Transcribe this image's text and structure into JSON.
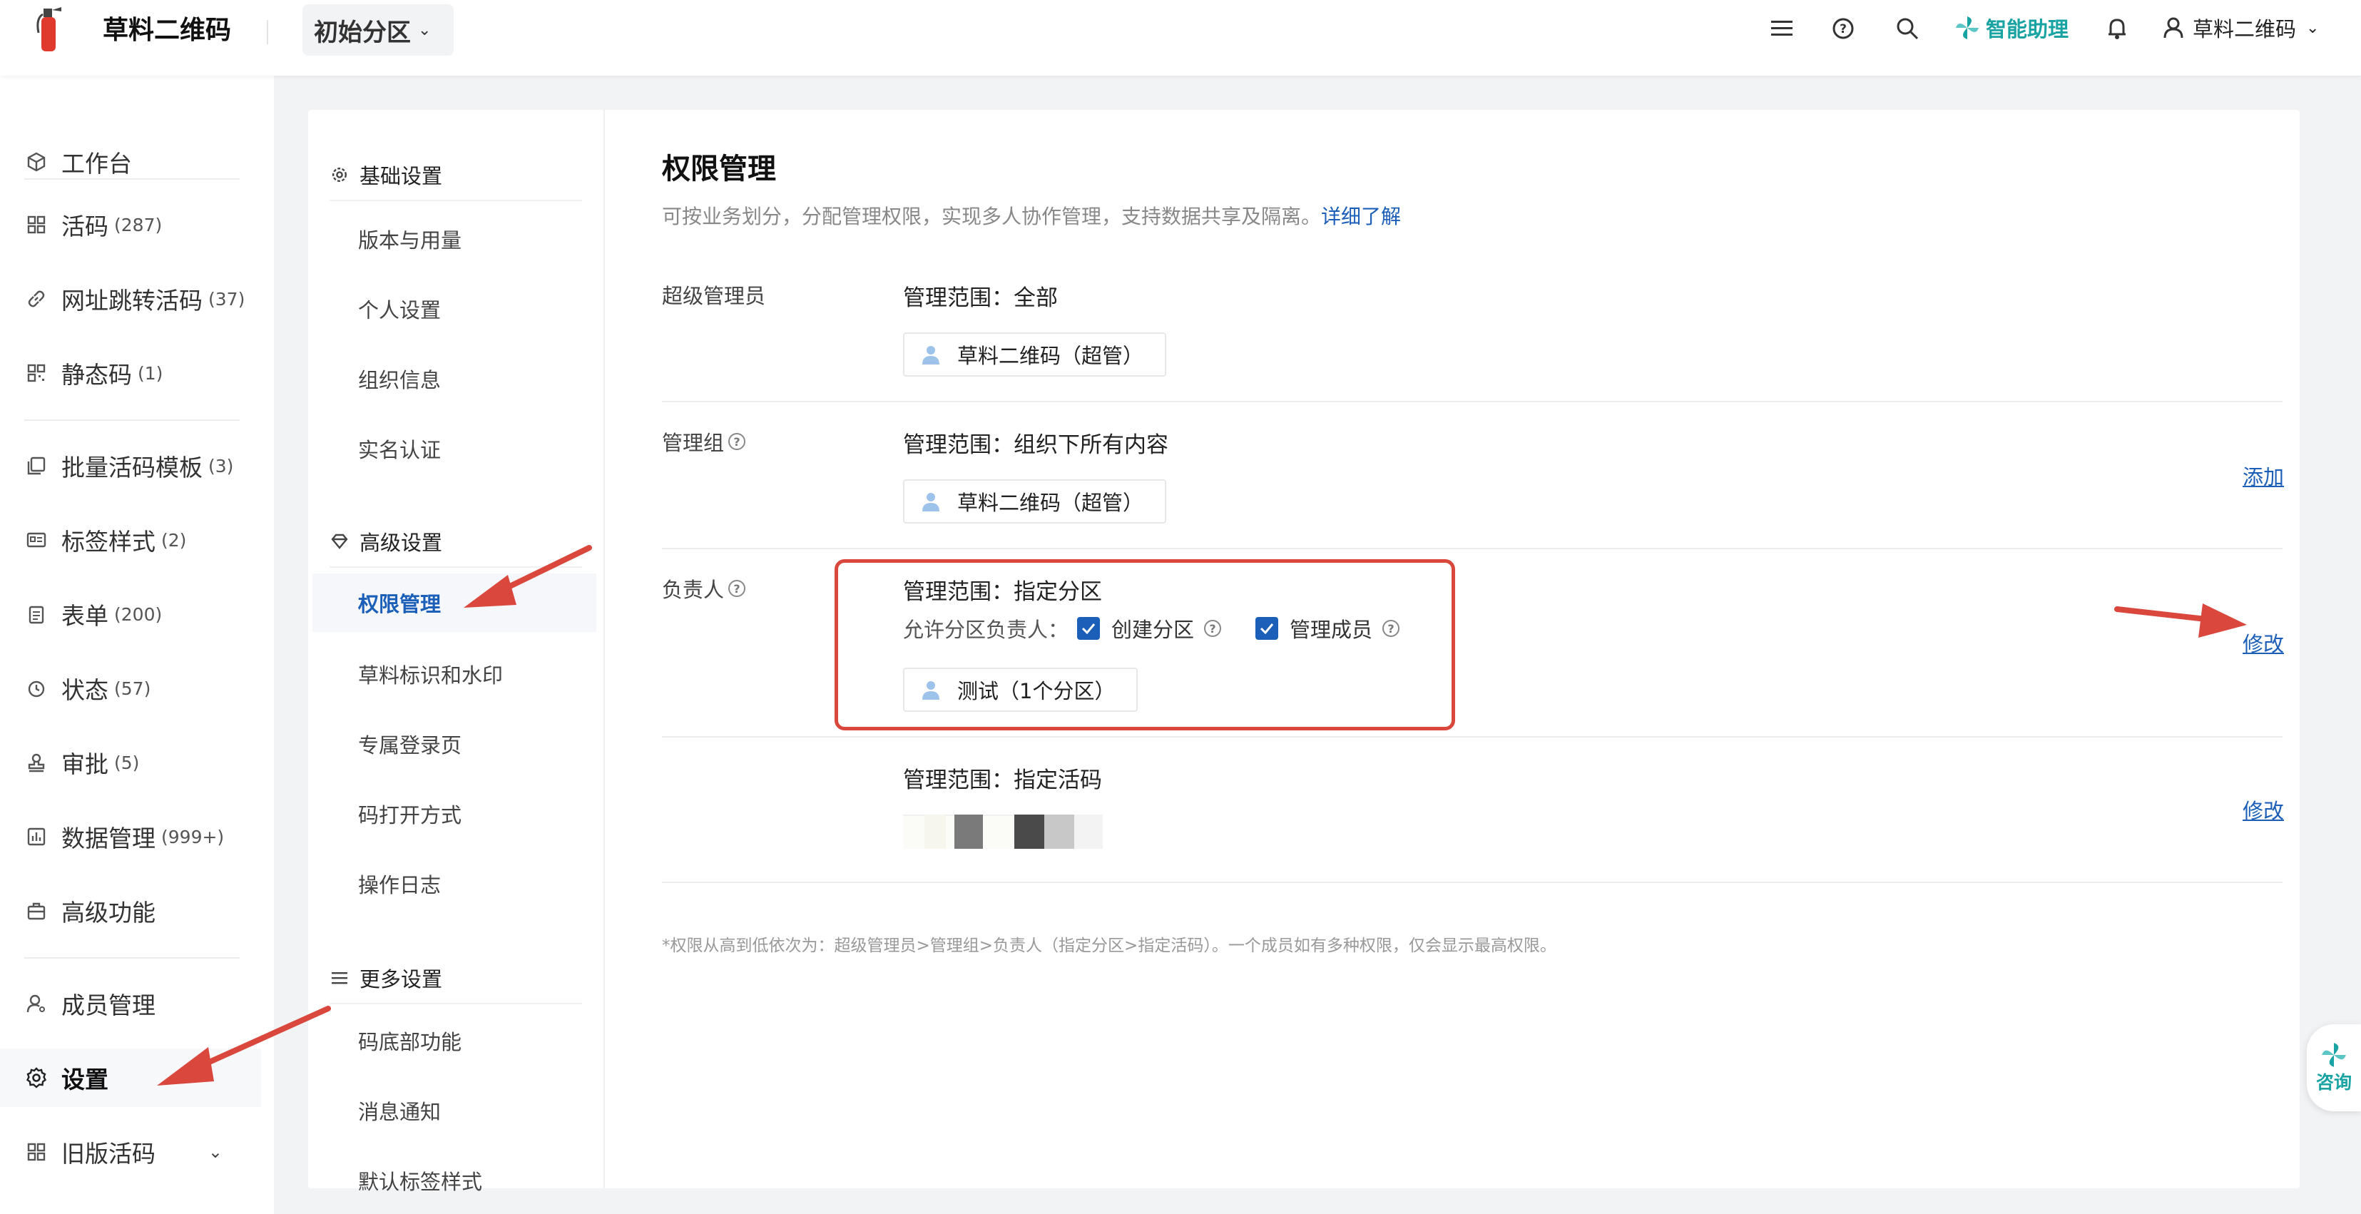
{
  "header": {
    "brand": "草料二维码",
    "partition": "初始分区",
    "assistant": "智能助理",
    "user": "草料二维码"
  },
  "sidebar": {
    "items": [
      {
        "label": "工作台",
        "count": "",
        "icon": "cube-icon"
      },
      {
        "label": "活码",
        "count": "(287)",
        "icon": "grid-icon"
      },
      {
        "label": "网址跳转活码",
        "count": "(37)",
        "icon": "link-icon"
      },
      {
        "label": "静态码",
        "count": "(1)",
        "icon": "qr-icon"
      },
      {
        "label": "批量活码模板",
        "count": "(3)",
        "icon": "layers-icon"
      },
      {
        "label": "标签样式",
        "count": "(2)",
        "icon": "label-icon"
      },
      {
        "label": "表单",
        "count": "(200)",
        "icon": "form-icon"
      },
      {
        "label": "状态",
        "count": "(57)",
        "icon": "status-icon"
      },
      {
        "label": "审批",
        "count": "(5)",
        "icon": "stamp-icon"
      },
      {
        "label": "数据管理",
        "count": "(999+)",
        "icon": "chart-icon"
      },
      {
        "label": "高级功能",
        "count": "",
        "icon": "briefcase-icon"
      },
      {
        "label": "成员管理",
        "count": "",
        "icon": "member-icon"
      },
      {
        "label": "设置",
        "count": "",
        "icon": "gear-icon"
      },
      {
        "label": "旧版活码",
        "count": "",
        "icon": "grid-icon"
      }
    ]
  },
  "subnav": {
    "basic_title": "基础设置",
    "basic_items": [
      "版本与用量",
      "个人设置",
      "组织信息",
      "实名认证"
    ],
    "advanced_title": "高级设置",
    "advanced_items": [
      "权限管理",
      "草料标识和水印",
      "专属登录页",
      "码打开方式",
      "操作日志"
    ],
    "more_title": "更多设置",
    "more_items": [
      "码底部功能",
      "消息通知",
      "默认标签样式"
    ]
  },
  "main": {
    "title": "权限管理",
    "desc": "可按业务划分，分配管理权限，实现多人协作管理，支持数据共享及隔离。",
    "desc_link": "详细了解",
    "super_admin": {
      "label": "超级管理员",
      "scope": "管理范围：全部",
      "member": "草料二维码（超管）"
    },
    "admin_group": {
      "label": "管理组",
      "scope": "管理范围：组织下所有内容",
      "member": "草料二维码（超管）",
      "action": "添加"
    },
    "owner": {
      "label": "负责人",
      "scope": "管理范围：指定分区",
      "allow_label": "允许分区负责人：",
      "opt1": "创建分区",
      "opt2": "管理成员",
      "member": "测试（1个分区）",
      "action": "修改"
    },
    "code_owner": {
      "scope": "管理范围：指定活码",
      "action": "修改"
    },
    "footnote": "*权限从高到低依次为：超级管理员>管理组>负责人（指定分区>指定活码）。一个成员如有多种权限，仅会显示最高权限。"
  },
  "consult": "咨询",
  "colors": {
    "accent": "#1c5fb8",
    "highlight": "#d9473d",
    "assistant": "#1aa3a3"
  }
}
